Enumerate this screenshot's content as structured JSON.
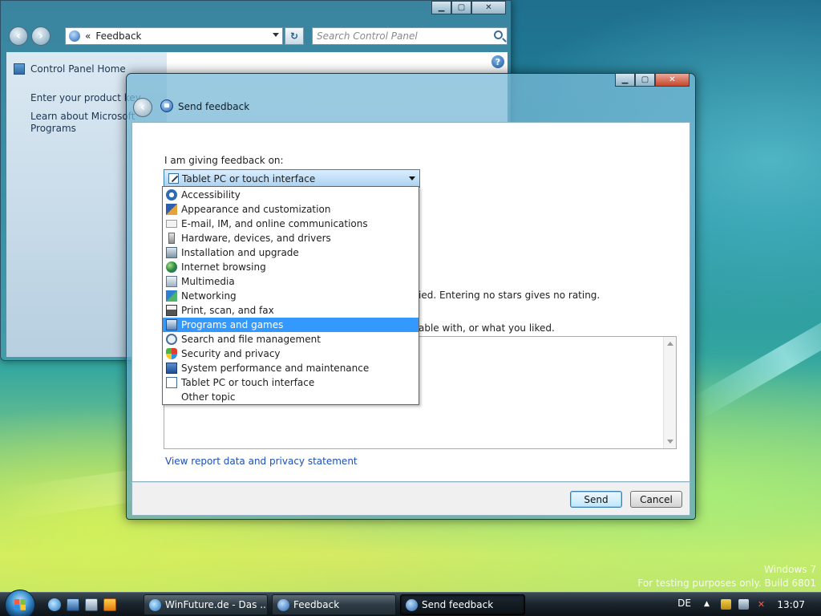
{
  "control_panel": {
    "address": {
      "chevron": "«",
      "path": "Feedback"
    },
    "search_placeholder": "Search Control Panel",
    "sidebar": {
      "home": "Control Panel Home",
      "links": [
        "Enter your product key",
        "Learn about Microsoft",
        "Programs"
      ]
    },
    "help_glyph": "?"
  },
  "dialog": {
    "title": "Send feedback",
    "giving_label": "I am giving feedback on:",
    "selected_topic": "Tablet PC or touch interface",
    "rating_hint_tail": "ied.  Entering no stars gives no rating.",
    "comment_hint_tail": "able with, or what you liked.",
    "privacy_link": "View report data and privacy statement",
    "send_label": "Send",
    "cancel_label": "Cancel"
  },
  "dropdown": {
    "options": [
      {
        "label": "Accessibility",
        "icon": "accessibility-icon"
      },
      {
        "label": "Appearance and customization",
        "icon": "appearance-icon"
      },
      {
        "label": "E-mail, IM, and online communications",
        "icon": "email-icon"
      },
      {
        "label": "Hardware, devices, and drivers",
        "icon": "hardware-icon"
      },
      {
        "label": "Installation and upgrade",
        "icon": "installation-icon"
      },
      {
        "label": "Internet browsing",
        "icon": "globe-icon"
      },
      {
        "label": "Multimedia",
        "icon": "multimedia-icon"
      },
      {
        "label": "Networking",
        "icon": "network-icon"
      },
      {
        "label": "Print, scan, and fax",
        "icon": "printer-icon"
      },
      {
        "label": "Programs and games",
        "icon": "programs-icon"
      },
      {
        "label": "Search and file management",
        "icon": "search-file-icon"
      },
      {
        "label": "Security and privacy",
        "icon": "shield-icon"
      },
      {
        "label": "System performance and maintenance",
        "icon": "system-icon"
      },
      {
        "label": "Tablet PC or touch interface",
        "icon": "tablet-icon"
      },
      {
        "label": "Other topic",
        "icon": ""
      }
    ],
    "selected_index": 9
  },
  "watermark": {
    "line1": "Windows 7",
    "line2": "For testing purposes only. Build 6801"
  },
  "taskbar": {
    "buttons": [
      {
        "label": "WinFuture.de - Das ..."
      },
      {
        "label": "Feedback"
      },
      {
        "label": "Send feedback"
      }
    ],
    "active_index": 2,
    "language": "DE",
    "clock": "13:07"
  },
  "colors": {
    "selection": "#3399ff",
    "link": "#1a4fb5",
    "close_button": "#c6462c"
  }
}
